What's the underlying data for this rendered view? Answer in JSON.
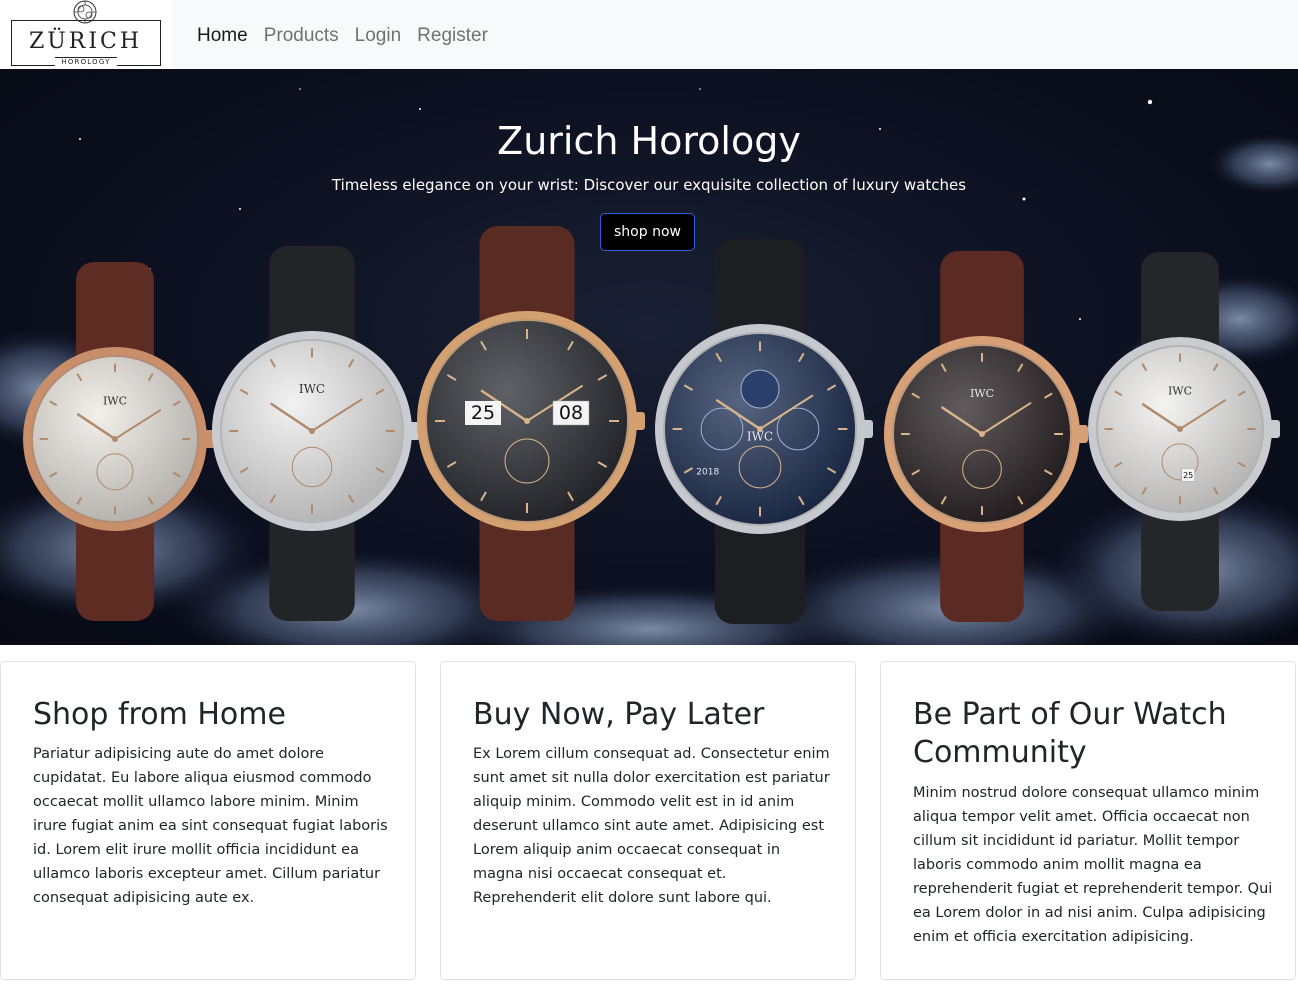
{
  "brand": {
    "logo_text": "ZÜRICH",
    "logo_subtext": "HOROLOGY"
  },
  "nav": {
    "items": [
      {
        "label": "Home",
        "active": true
      },
      {
        "label": "Products",
        "active": false
      },
      {
        "label": "Login",
        "active": false
      },
      {
        "label": "Register",
        "active": false
      }
    ]
  },
  "hero": {
    "title": "Zurich Horology",
    "subtitle": "Timeless elegance on your wrist: Discover our exquisite collection of luxury watches",
    "button_label": "shop now",
    "watches": [
      {
        "case": "#c98f6a",
        "strap": "#5e2c22",
        "dial": "#efeae4",
        "brand": "IWC"
      },
      {
        "case": "#c9ccd1",
        "strap": "#222428",
        "dial": "#eeeeef",
        "brand": "IWC"
      },
      {
        "case": "#d4a070",
        "strap": "#5a2b22",
        "dial": "#2a2d33",
        "brand": "",
        "date_left": "25",
        "date_right": "08"
      },
      {
        "case": "#c5c8cd",
        "strap": "#1c1e22",
        "dial": "#1f3156",
        "brand": "IWC",
        "year": "2018"
      },
      {
        "case": "#d7a076",
        "strap": "#5b2a22",
        "dial": "#2b2426",
        "brand": "IWC"
      },
      {
        "case": "#c9cbcf",
        "strap": "#24262a",
        "dial": "#f0efee",
        "brand": "IWC",
        "date_right": "25"
      }
    ]
  },
  "cards": [
    {
      "title": "Shop from Home",
      "text": "Pariatur adipisicing aute do amet dolore cupidatat. Eu labore aliqua eiusmod commodo occaecat mollit ullamco labore minim. Minim irure fugiat anim ea sint consequat fugiat laboris id. Lorem elit irure mollit officia incididunt ea ullamco laboris excepteur amet. Cillum pariatur consequat adipisicing aute ex."
    },
    {
      "title": "Buy Now, Pay Later",
      "text": "Ex Lorem cillum consequat ad. Consectetur enim sunt amet sit nulla dolor exercitation est pariatur aliquip minim. Commodo velit est in id anim deserunt ullamco sint aute amet. Adipisicing est Lorem aliquip anim occaecat consequat in magna nisi occaecat consequat et. Reprehenderit elit dolore sunt labore qui."
    },
    {
      "title": "Be Part of Our Watch Community",
      "text": "Minim nostrud dolore consequat ullamco minim aliqua tempor velit amet. Officia occaecat non cillum sit incididunt id pariatur. Mollit tempor laboris commodo anim mollit magna ea reprehenderit fugiat et reprehenderit tempor. Qui ea Lorem dolor in ad nisi anim. Culpa adipisicing enim et officia exercitation adipisicing."
    }
  ]
}
